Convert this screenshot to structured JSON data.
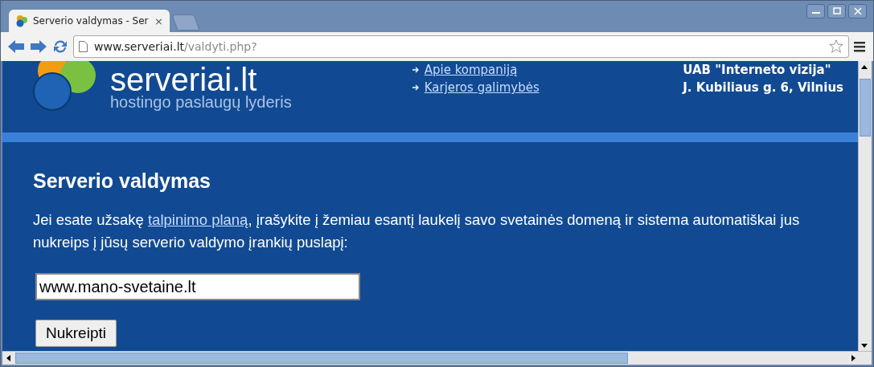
{
  "tabs": [
    {
      "title": "Serverio valdymas - Ser",
      "close": "×",
      "selected": true
    }
  ],
  "address": {
    "host": "www.serveriai.lt",
    "path": "/valdyti.php?"
  },
  "header": {
    "logo": "serveriai.lt",
    "slogan": "hostingo paslaugų lyderis",
    "links": [
      "Apie kompaniją",
      "Karjeros galimybės"
    ],
    "company": "UAB \"Interneto vizija\"",
    "address": "J. Kubiliaus g. 6, Vilnius"
  },
  "main": {
    "heading": "Serverio valdymas",
    "text_before": "Jei esate užsakę ",
    "link": "talpinimo planą",
    "text_after": ", įrašykite į žemiau esantį laukelį savo svetainės domeną ir sistema automatiškai jus nukreips į jūsų serverio valdymo įrankių puslapį:",
    "domain": "www.mano-svetaine.lt",
    "button": "Nukreipti"
  }
}
